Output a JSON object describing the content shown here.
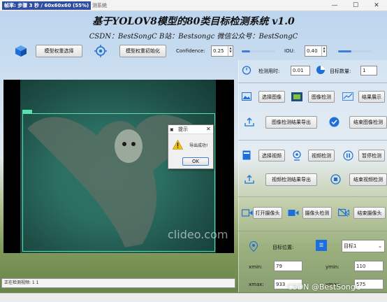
{
  "window": {
    "fps_overlay": "帧率: 步骤 3 秒 / 60x60x60 (55%)",
    "title": "测系统",
    "minimize": "—",
    "maximize": "☐",
    "close": "✕"
  },
  "header": {
    "title": "基于YOLOV8模型的80类目标检测系统 v1.0",
    "subtitle": "CSDN：BestSongC   B站：Bestsongc   微信公众号：BestSongC"
  },
  "toolbar": {
    "model_select_label": "模型权重选择",
    "model_init_label": "模型权重初始化",
    "confidence_label": "Confidence:",
    "confidence_value": "0.25",
    "confidence_level": 0.25,
    "iou_label": "IOU:",
    "iou_value": "0.40",
    "iou_level": 0.4
  },
  "video": {
    "watermark": "clideo.com"
  },
  "dialog": {
    "title": "提示",
    "message": "导出成功!",
    "ok_label": "OK"
  },
  "panel": {
    "time_label": "检测用时:",
    "time_value": "0.01",
    "count_label": "目标数量:",
    "count_value": "1",
    "select_image": "选择图像",
    "image_detect": "图像检测",
    "show_results": "结果展示",
    "export_image_results": "图像检测结果导出",
    "stop_image_detect": "结束图像检测",
    "select_video": "选择视频",
    "video_detect": "视频检测",
    "pause_detect": "暂停检测",
    "export_video_results": "视频检测结果导出",
    "stop_video_detect": "结束视频检测",
    "open_camera": "打开摄像头",
    "camera_detect": "摄像头检测",
    "close_camera": "结束摄像头",
    "target_position_label": "目标位置:",
    "target_select": "目标1",
    "xmin_label": "xmin:",
    "xmin_value": "79",
    "ymin_label": "ymin:",
    "ymin_value": "110",
    "xmax_label": "xmax:",
    "xmax_value": "933",
    "ymax_label": "ymax:",
    "ymax_value": "575"
  },
  "status": {
    "text": "正在检测视频: 1 1"
  },
  "footer": {
    "csdn_watermark": "CSDN @BestSongC"
  },
  "colors": {
    "accent": "#3c7fd6",
    "detection_box": "#57e0b0",
    "icon_blue": "#1e6fd9"
  }
}
